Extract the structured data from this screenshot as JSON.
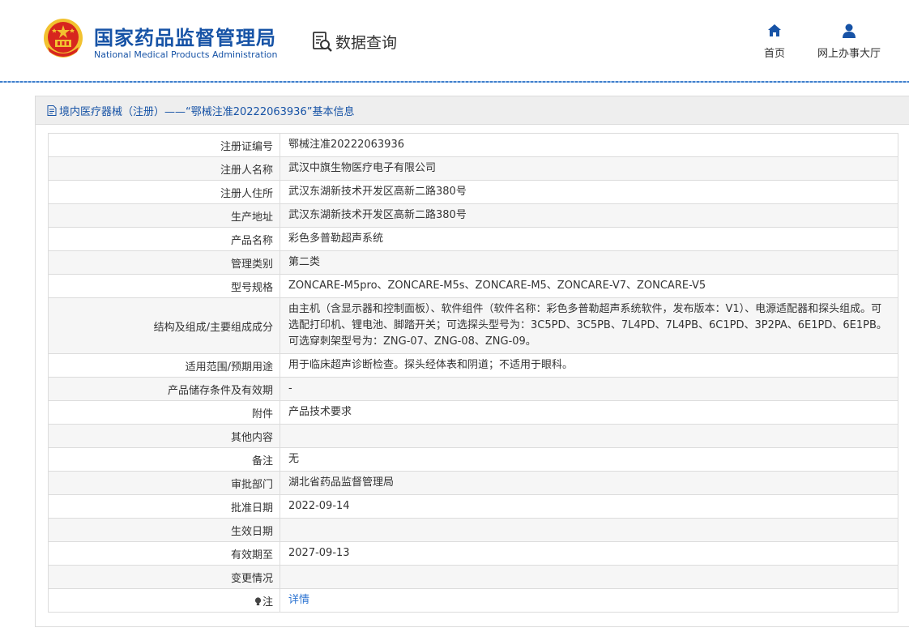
{
  "header": {
    "brand_cn": "国家药品监督管理局",
    "brand_en": "National Medical Products Administration",
    "query_label": "数据查询",
    "nav": [
      {
        "label": "首页",
        "icon": "home-icon"
      },
      {
        "label": "网上办事大厅",
        "icon": "user-icon"
      }
    ]
  },
  "panel": {
    "title": "境内医疗器械（注册）——“鄂械注准20222063936”基本信息"
  },
  "rows": [
    {
      "label": "注册证编号",
      "value": "鄂械注准20222063936"
    },
    {
      "label": "注册人名称",
      "value": "武汉中旗生物医疗电子有限公司"
    },
    {
      "label": "注册人住所",
      "value": "武汉东湖新技术开发区高新二路380号"
    },
    {
      "label": "生产地址",
      "value": "武汉东湖新技术开发区高新二路380号"
    },
    {
      "label": "产品名称",
      "value": "彩色多普勒超声系统"
    },
    {
      "label": "管理类别",
      "value": "第二类"
    },
    {
      "label": "型号规格",
      "value": "ZONCARE-M5pro、ZONCARE-M5s、ZONCARE-M5、ZONCARE-V7、ZONCARE-V5"
    },
    {
      "label": "结构及组成/主要组成成分",
      "value": "由主机（含显示器和控制面板）、软件组件（软件名称：彩色多普勒超声系统软件，发布版本：V1）、电源适配器和探头组成。可选配打印机、锂电池、脚踏开关；可选探头型号为：3C5PD、3C5PB、7L4PD、7L4PB、6C1PD、3P2PA、6E1PD、6E1PB。可选穿刺架型号为：ZNG-07、ZNG-08、ZNG-09。"
    },
    {
      "label": "适用范围/预期用途",
      "value": "用于临床超声诊断检查。探头经体表和阴道；不适用于眼科。"
    },
    {
      "label": "产品储存条件及有效期",
      "value": "-"
    },
    {
      "label": "附件",
      "value": "产品技术要求"
    },
    {
      "label": "其他内容",
      "value": ""
    },
    {
      "label": "备注",
      "value": "无"
    },
    {
      "label": "审批部门",
      "value": "湖北省药品监督管理局"
    },
    {
      "label": "批准日期",
      "value": "2022-09-14"
    },
    {
      "label": "生效日期",
      "value": ""
    },
    {
      "label": "有效期至",
      "value": "2027-09-13"
    },
    {
      "label": "变更情况",
      "value": ""
    },
    {
      "label": "注",
      "value": "详情",
      "icon": "lightbulb-icon"
    }
  ],
  "colors": {
    "brand_blue": "#1753a6",
    "link_blue": "#2b73d1",
    "emblem_red": "#d7261e",
    "emblem_gold": "#f2c230"
  }
}
